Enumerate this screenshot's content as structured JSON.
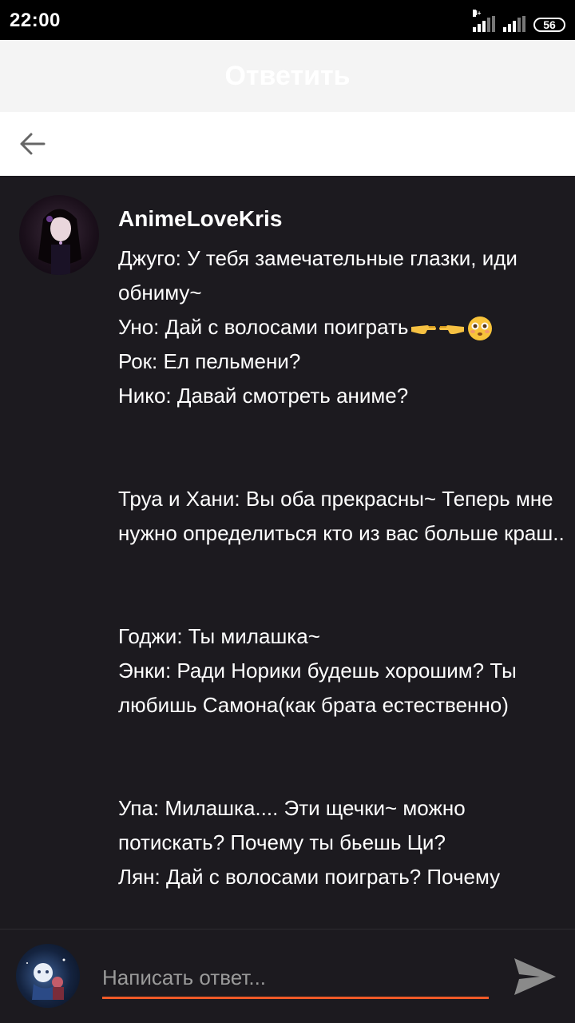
{
  "status_bar": {
    "time": "22:00",
    "network_label": "H+",
    "battery": "56"
  },
  "header": {
    "title": "Ответить"
  },
  "post": {
    "username": "AnimeLoveKris",
    "lines": [
      "Джуго: У тебя замечательные глазки, иди обниму~",
      "Уно: Дай с волосами поиграть",
      "Рок: Ел пельмени?",
      "Нико: Давай смотреть аниме?",
      "",
      "Труа и Хани: Вы оба прекрасны~ Теперь мне нужно определиться кто из вас больше краш..",
      "",
      "Годжи: Ты милашка~",
      "Энки: Ради Норики будешь хорошим? Ты любишь Самона(как брата естественно)",
      "",
      "Упа: Милашка.... Эти щечки~ можно потискать? Почему ты бьешь Ци?",
      "Лян: Дай с волосами поиграть? Почему"
    ],
    "emojis": [
      "pointing-right-emoji",
      "pointing-left-emoji",
      "flushed-face-emoji"
    ]
  },
  "reply": {
    "placeholder": "Написать ответ..."
  },
  "icons": {
    "back": "arrow-left-icon",
    "send": "send-icon"
  },
  "colors": {
    "accent": "#f05a28",
    "background": "#1c1a1f",
    "header": "#f4f4f4"
  }
}
